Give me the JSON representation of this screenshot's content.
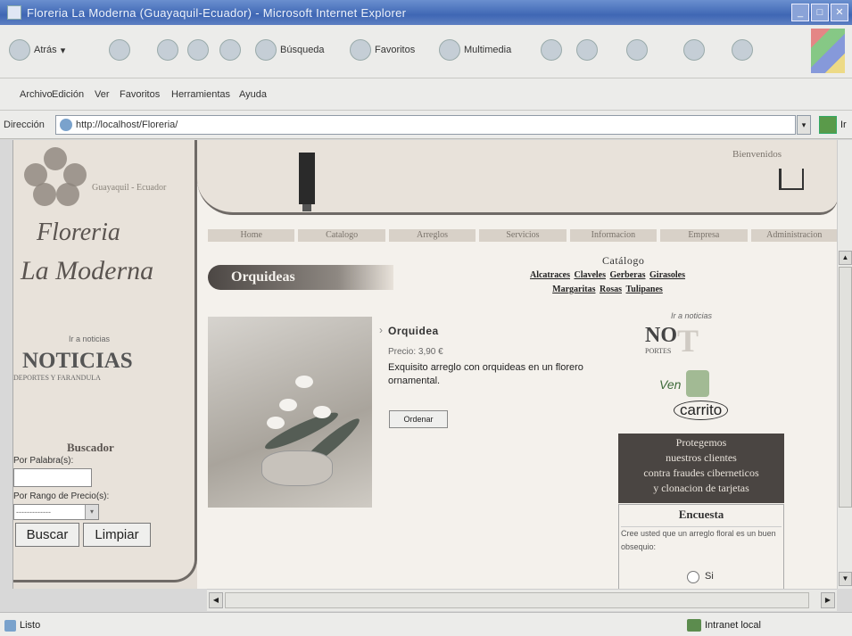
{
  "window": {
    "title": "Floreria La Moderna (Guayaquil-Ecuador) - Microsoft Internet Explorer",
    "controls": [
      "_",
      "□",
      "✕"
    ]
  },
  "toolbar": {
    "back": "Atrás",
    "search": "Búsqueda",
    "favorites": "Favoritos",
    "media": "Multimedia"
  },
  "menu": [
    "Archivo",
    "Edición",
    "Ver",
    "Favoritos",
    "Herramientas",
    "Ayuda"
  ],
  "address": {
    "label": "Dirección",
    "url": "http://localhost/Floreria/",
    "go": "Ir"
  },
  "sidebar": {
    "logo_small": "Guayaquil - Ecuador",
    "brand_line1": "Floreria",
    "brand_line2": "La Moderna",
    "ir_noticias": "Ir a noticias",
    "noticias": "NOTICIAS",
    "noticias_sub": "DEPORTES Y FARANDULA",
    "buscador": "Buscador",
    "por_palabra": "Por Palabra(s):",
    "por_rango": "Por Rango de Precio(s):",
    "rango_value": "-------------",
    "buscar": "Buscar",
    "limpiar": "Limpiar"
  },
  "header": {
    "bienvenidos": "Bienvenidos"
  },
  "nav": [
    "Home",
    "Catalogo",
    "Arreglos",
    "Servicios",
    "Informacion",
    "Empresa",
    "Administracion"
  ],
  "section": {
    "title": "Orquideas"
  },
  "catalog": {
    "title": "Catálogo",
    "links": [
      "Alcatraces",
      "Claveles",
      "Gerberas",
      "Girasoles",
      "Margaritas",
      "Rosas",
      "Tulipanes"
    ]
  },
  "product": {
    "name": "Orquidea",
    "price": "Precio: 3,90 €",
    "description": "Exquisito arreglo con orquideas en un florero ornamental.",
    "order_button": "Ordenar"
  },
  "right": {
    "ir_noticias": "Ir a noticias",
    "not_banner": "NO",
    "not_banner_t": "T",
    "not_banner_sub": "PORTES",
    "ven": "Ven",
    "carrito": "carrito",
    "protect_lines": [
      "Protegemos",
      "nuestros clientes",
      "contra fraudes ciberneticos",
      "y clonacion de tarjetas"
    ],
    "encuesta_title": "Encuesta",
    "encuesta_question": "Cree usted que un arreglo floral es un buen obsequio:",
    "encuesta_option": "Si"
  },
  "status": {
    "left": "Listo",
    "zone": "Intranet local"
  }
}
